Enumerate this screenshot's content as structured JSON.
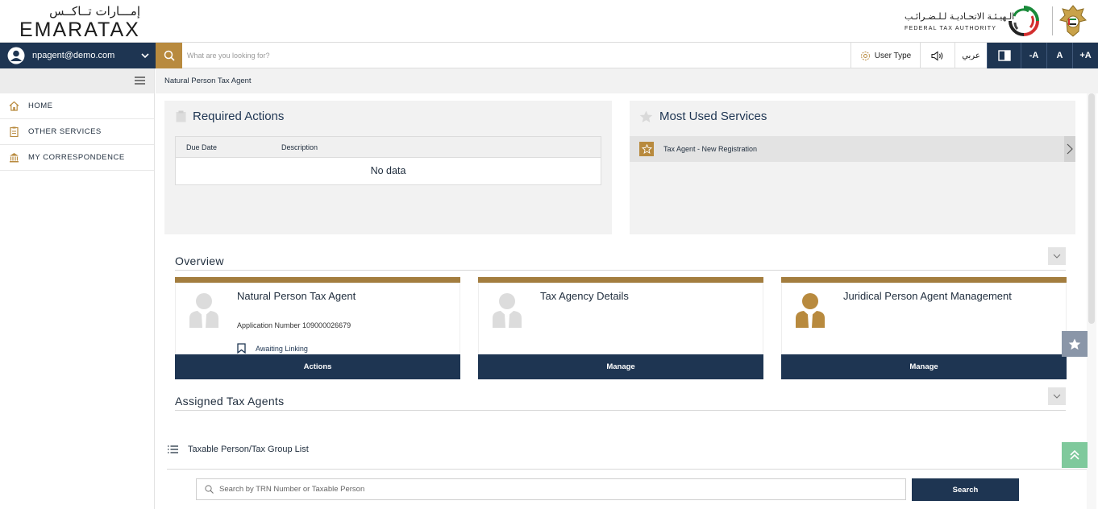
{
  "header": {
    "logo_ar": "إمـــارات تــاكــس",
    "logo_en": "EMARATAX",
    "fta_ar": "الـهيـئـة الاتحـاديـة لـلـضـرائـب",
    "fta_en": "FEDERAL TAX AUTHORITY"
  },
  "toolbar": {
    "user_email": "npagent@demo.com",
    "search_placeholder": "What are you looking for?",
    "user_type_label": "User Type",
    "arabic_label": "عربي",
    "font_minus": "-A",
    "font_normal": "A",
    "font_plus": "+A"
  },
  "sidebar": {
    "items": [
      {
        "label": "HOME",
        "icon": "home-icon"
      },
      {
        "label": "OTHER SERVICES",
        "icon": "clipboard-icon"
      },
      {
        "label": "MY CORRESPONDENCE",
        "icon": "building-icon"
      }
    ]
  },
  "breadcrumb": "Natural Person Tax Agent",
  "required_actions": {
    "title": "Required Actions",
    "col_due": "Due Date",
    "col_desc": "Description",
    "empty": "No data"
  },
  "most_used": {
    "title": "Most Used Services",
    "items": [
      {
        "label": "Tax Agent - New Registration"
      }
    ]
  },
  "overview": {
    "title": "Overview",
    "cards": [
      {
        "title": "Natural Person Tax Agent",
        "subtitle": "Application Number 109000026679",
        "status": "Awaiting Linking",
        "button": "Actions"
      },
      {
        "title": "Tax Agency Details",
        "button": "Manage"
      },
      {
        "title": "Juridical Person Agent Management",
        "button": "Manage"
      }
    ]
  },
  "assigned": {
    "title": "Assigned Tax Agents",
    "list_label": "Taxable Person/Tax Group List",
    "search_placeholder": "Search by TRN Number or Taxable Person",
    "search_button": "Search"
  },
  "colors": {
    "navy": "#1e3552",
    "gold": "#b88a3e"
  }
}
